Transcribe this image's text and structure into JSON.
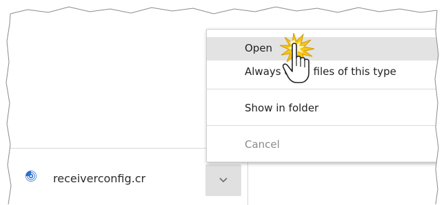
{
  "download": {
    "file_name": "receiverconfig.cr",
    "file_icon": "receiver-config-swirl-icon",
    "menu_button_icon": "chevron-down-icon"
  },
  "context_menu": {
    "items": [
      {
        "label": "Open",
        "highlighted": true,
        "enabled": true
      },
      {
        "label": "Always open files of this type",
        "highlighted": false,
        "enabled": true
      },
      {
        "label": "Show in folder",
        "highlighted": false,
        "enabled": true
      },
      {
        "label": "Cancel",
        "highlighted": false,
        "enabled": false
      }
    ]
  },
  "cursor": {
    "icon": "hand-pointer-icon",
    "effect": "click-burst"
  },
  "colors": {
    "highlight": "#e3e3e3",
    "file_icon_blue": "#2b6fcf",
    "click_burst": "#f5c518"
  }
}
